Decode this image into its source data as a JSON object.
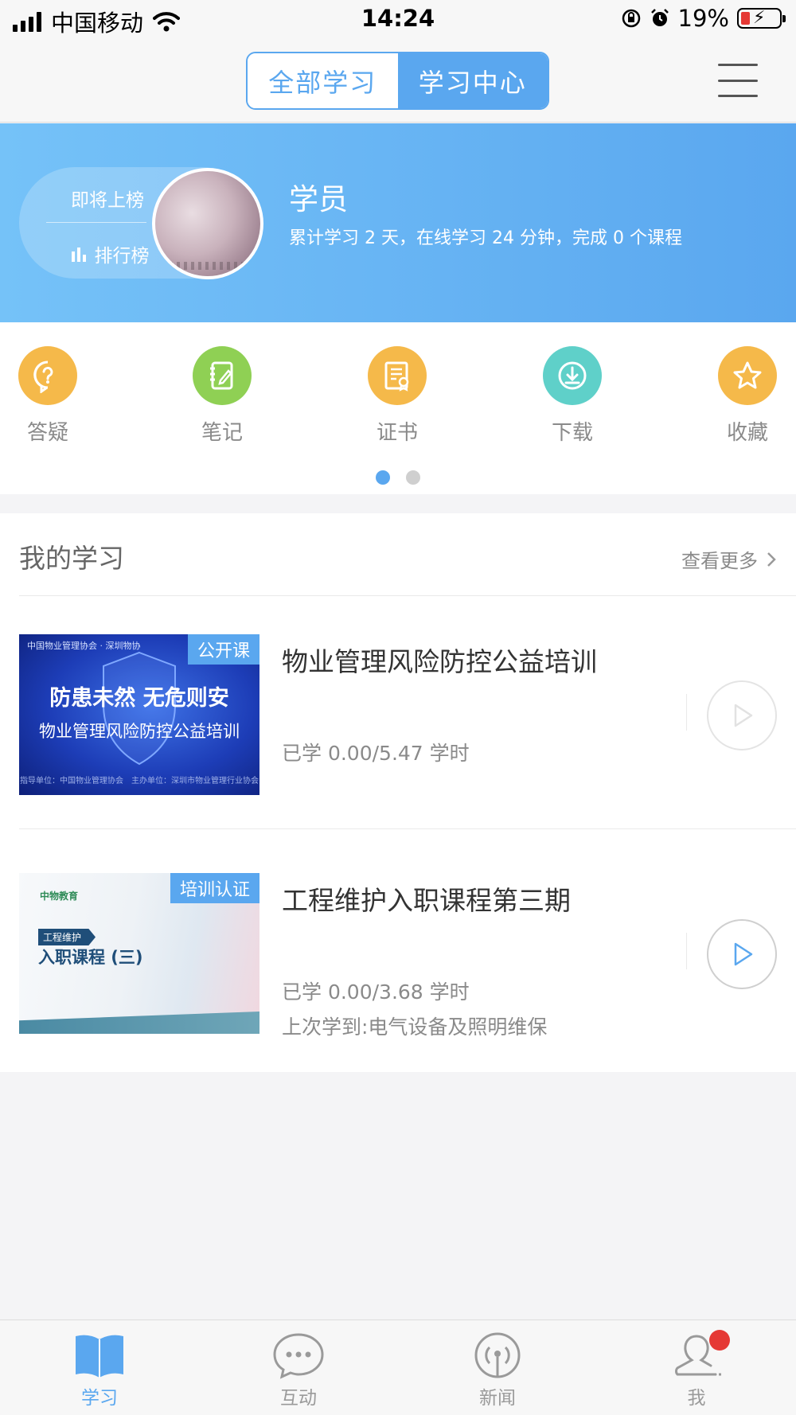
{
  "status_bar": {
    "carrier": "中国移动",
    "time": "14:24",
    "battery": "19%"
  },
  "nav": {
    "tabs": [
      {
        "label": "全部学习",
        "active": false
      },
      {
        "label": "学习中心",
        "active": true
      }
    ],
    "menu_icon": "hamburger-menu-icon"
  },
  "banner": {
    "rank_status": "即将上榜",
    "rank_link": "排行榜",
    "user_name": "学员",
    "stats": "累计学习 2 天，在线学习 24 分钟，完成 0 个课程"
  },
  "quick_actions": [
    {
      "label": "答疑",
      "icon": "question-bubble-icon",
      "color": "#f5b94a"
    },
    {
      "label": "笔记",
      "icon": "notebook-icon",
      "color": "#8fd054"
    },
    {
      "label": "证书",
      "icon": "certificate-icon",
      "color": "#f5b94a"
    },
    {
      "label": "下载",
      "icon": "download-icon",
      "color": "#5fd0c9"
    },
    {
      "label": "收藏",
      "icon": "star-icon",
      "color": "#f5b94a"
    }
  ],
  "pager": {
    "pages": 2,
    "current": 1
  },
  "my_learning": {
    "title": "我的学习",
    "more": "查看更多",
    "courses": [
      {
        "title": "物业管理风险防控公益培训",
        "badge": "公开课",
        "progress": "已学 0.00/5.47 学时",
        "thumb_line1": "防患未然 无危则安",
        "thumb_line2": "物业管理风险防控公益培训",
        "thumb_top": "中国物业管理协会 · 深圳物协",
        "thumb_foot": "指导单位：中国物业管理协会　主办单位：深圳市物业管理行业协会"
      },
      {
        "title": "工程维护入职课程第三期",
        "badge": "培训认证",
        "progress": "已学 0.00/3.68 学时",
        "last": "上次学到:电气设备及照明维保",
        "thumb_logo": "中物教育",
        "thumb_tag": "工程维护",
        "thumb_title": "入职课程 (三)"
      }
    ]
  },
  "tab_bar": [
    {
      "label": "学习",
      "icon": "book-icon",
      "active": true
    },
    {
      "label": "互动",
      "icon": "chat-bubble-icon",
      "active": false
    },
    {
      "label": "新闻",
      "icon": "broadcast-icon",
      "active": false
    },
    {
      "label": "我",
      "icon": "person-icon",
      "active": false,
      "badge": true
    }
  ],
  "colors": {
    "accent": "#5aa7ef",
    "badge_red": "#e53935"
  }
}
